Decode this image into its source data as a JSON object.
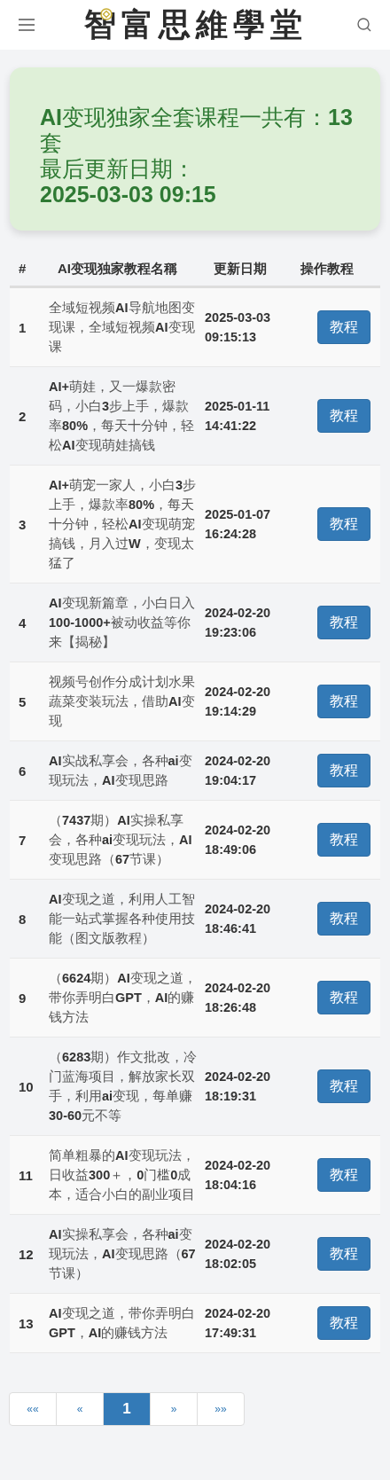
{
  "header": {
    "logo": "智富思維學堂"
  },
  "summary": {
    "count_text": "**AI**变现独家全套课程一共有：**13** 套",
    "updated_label": "最后更新日期：",
    "updated_value": "2025-03-03 09:15"
  },
  "table": {
    "columns": [
      "#",
      "AI变现独家教程名稱",
      "更新日期",
      "操作教程"
    ],
    "rows": [
      {
        "index": "1",
        "name": "全域短视频**AI**导航地图变现课，全域短视频**AI**变现课",
        "date": "2025-03-03 09:15:13",
        "action": "教程"
      },
      {
        "index": "2",
        "name": "**AI+**萌娃，又一爆款密码，小白**3**步上手，爆款率**80%**，每天十分钟，轻松**AI**变现萌娃搞钱",
        "date": "2025-01-11 14:41:22",
        "action": "教程"
      },
      {
        "index": "3",
        "name": "**AI+**萌宠一家人，小白**3**步上手，爆款率**80%**，每天十分钟，轻松**AI**变现萌宠搞钱，月入过**W**，变现太猛了",
        "date": "2025-01-07 16:24:28",
        "action": "教程"
      },
      {
        "index": "4",
        "name": "**AI**变现新篇章，小白日入**100-1000+**被动收益等你来【揭秘】",
        "date": "2024-02-20 19:23:06",
        "action": "教程"
      },
      {
        "index": "5",
        "name": "视频号创作分成计划水果蔬菜变装玩法，借助**AI**变现",
        "date": "2024-02-20 19:14:29",
        "action": "教程"
      },
      {
        "index": "6",
        "name": "**AI**实战私享会，各种**ai**变现玩法，**AI**变现思路",
        "date": "2024-02-20 19:04:17",
        "action": "教程"
      },
      {
        "index": "7",
        "name": "（**7437**期）**AI**实操私享会，各种**ai**变现玩法，**AI**变现思路（**67**节课）",
        "date": "2024-02-20 18:49:06",
        "action": "教程"
      },
      {
        "index": "8",
        "name": "**AI**变现之道，利用人工智能一站式掌握各种使用技能（图文版教程）",
        "date": "2024-02-20 18:46:41",
        "action": "教程"
      },
      {
        "index": "9",
        "name": "（**6624**期）**AI**变现之道，带你弄明白**GPT**，**AI**的赚钱方法",
        "date": "2024-02-20 18:26:48",
        "action": "教程"
      },
      {
        "index": "10",
        "name": "（**6283**期）作文批改，冷门蓝海项目，解放家长双手，利用**ai**变现，每单赚**30-60**元不等",
        "date": "2024-02-20 18:19:31",
        "action": "教程"
      },
      {
        "index": "11",
        "name": "简单粗暴的**AI**变现玩法，日收益**300**＋，**0**门槛**0**成本，适合小白的副业项目",
        "date": "2024-02-20 18:04:16",
        "action": "教程"
      },
      {
        "index": "12",
        "name": "**AI**实操私享会，各种**ai**变现玩法，**AI**变现思路（**67**节课）",
        "date": "2024-02-20 18:02:05",
        "action": "教程"
      },
      {
        "index": "13",
        "name": "**AI**变现之道，带你弄明白**GPT**，**AI**的赚钱方法",
        "date": "2024-02-20 17:49:31",
        "action": "教程"
      }
    ]
  },
  "pagination": [
    {
      "label": "««",
      "selected": false
    },
    {
      "label": "«",
      "selected": false
    },
    {
      "label": "1",
      "selected": true
    },
    {
      "label": "»",
      "selected": false
    },
    {
      "label": "»»",
      "selected": false
    }
  ]
}
